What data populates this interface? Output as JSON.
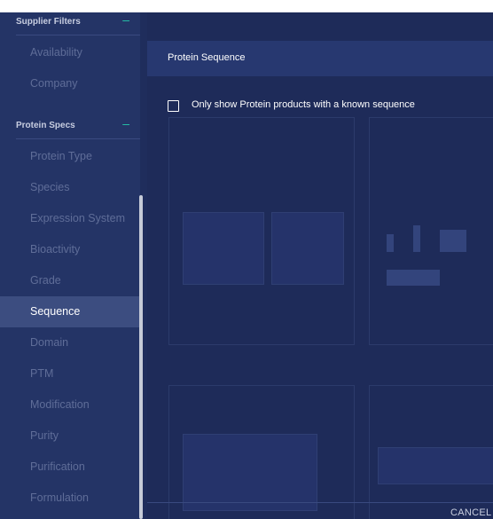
{
  "sidebar": {
    "supplier_filters": {
      "title": "Supplier Filters",
      "toggle": "–",
      "items": [
        "Availability",
        "Company"
      ]
    },
    "protein_specs": {
      "title": "Protein Specs",
      "toggle": "–",
      "items": [
        "Protein Type",
        "Species",
        "Expression System",
        "Bioactivity",
        "Grade",
        "Sequence",
        "Domain",
        "PTM",
        "Modification",
        "Purity",
        "Purification",
        "Formulation"
      ],
      "active": "Sequence"
    }
  },
  "modal": {
    "title": "Protein Sequence",
    "option_label": "Only show Protein products with a known sequence",
    "option_checked": false,
    "cancel_label": "CANCEL"
  },
  "colors": {
    "sidebar_bg": "#243466",
    "active_item_bg": "#3c4d80",
    "accent": "#25c4a8",
    "overlay_bg": "#1e2b59"
  }
}
